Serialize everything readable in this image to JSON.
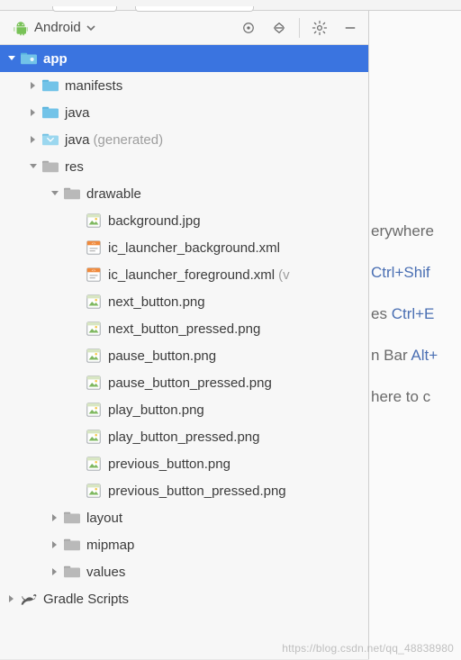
{
  "toolbar": {
    "title": "Android"
  },
  "tree": {
    "app": {
      "label": "app",
      "children": {
        "manifests": {
          "label": "manifests"
        },
        "java": {
          "label": "java"
        },
        "java_gen": {
          "label": "java",
          "suffix": "(generated)"
        },
        "res": {
          "label": "res",
          "drawable": {
            "label": "drawable",
            "files": [
              {
                "name": "background.jpg",
                "type": "img"
              },
              {
                "name": "ic_launcher_background.xml",
                "type": "xml"
              },
              {
                "name": "ic_launcher_foreground.xml",
                "type": "xml",
                "suffix": "(v"
              },
              {
                "name": "next_button.png",
                "type": "img"
              },
              {
                "name": "next_button_pressed.png",
                "type": "img"
              },
              {
                "name": "pause_button.png",
                "type": "img"
              },
              {
                "name": "pause_button_pressed.png",
                "type": "img"
              },
              {
                "name": "play_button.png",
                "type": "img"
              },
              {
                "name": "play_button_pressed.png",
                "type": "img"
              },
              {
                "name": "previous_button.png",
                "type": "img"
              },
              {
                "name": "previous_button_pressed.png",
                "type": "img"
              }
            ]
          },
          "layout": {
            "label": "layout"
          },
          "mipmap": {
            "label": "mipmap"
          },
          "values": {
            "label": "values"
          }
        }
      }
    },
    "gradle": {
      "label": "Gradle Scripts"
    }
  },
  "editor": {
    "lines": [
      {
        "text": "erywhere"
      },
      {
        "kb": "Ctrl+Shif"
      },
      {
        "text": "es ",
        "kb": "Ctrl+E"
      },
      {
        "text": "n Bar ",
        "kb": "Alt+"
      },
      {
        "text": "here to c"
      }
    ]
  },
  "watermark": "https://blog.csdn.net/qq_48838980"
}
